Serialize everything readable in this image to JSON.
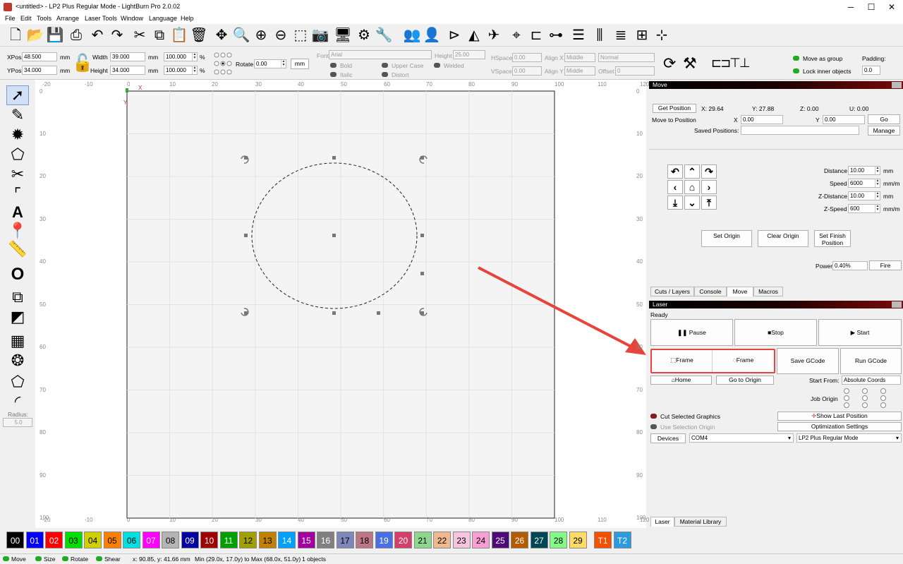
{
  "window": {
    "title": "<untitled> - LP2 Plus Regular Mode - LightBurn Pro 2.0.02",
    "min": "─",
    "max": "☐",
    "close": "✕"
  },
  "menu": [
    "File",
    "Edit",
    "Tools",
    "Arrange",
    "Laser Tools",
    "Window",
    "Language",
    "Help"
  ],
  "props": {
    "xpos_label": "XPos",
    "xpos": "48.500",
    "ypos_label": "YPos",
    "ypos": "34.000",
    "unit": "mm",
    "width_label": "Width",
    "width": "39.000",
    "height_label": "Height",
    "height": "34.000",
    "wpct": "100.000",
    "hpct": "100.000",
    "pct": "%",
    "rotate_label": "Rotate",
    "rotate": "0.00",
    "mm_button": "mm",
    "font_label": "Font",
    "font": "Arial",
    "fheight_label": "Height",
    "fheight": "25.00",
    "bold": "Bold",
    "italic": "Italic",
    "upper": "Upper Case",
    "distort": "Distort",
    "welded": "Welded",
    "hspace_label": "HSpace",
    "hspace": "0.00",
    "vspace_label": "VSpace",
    "vspace": "0.00",
    "alignx_label": "Align X",
    "alignx": "Middle",
    "aligny_label": "Align Y",
    "aligny": "Middle",
    "normal": "Normal",
    "offset_label": "Offset",
    "offset": "0",
    "move_group": "Move as group",
    "lock_inner": "Lock inner objects",
    "padding_label": "Padding:",
    "padding": "0.0"
  },
  "toolbox": {
    "radius_label": "Radius:",
    "radius": "5.0"
  },
  "ruler": {
    "x": [
      "-20",
      "-10",
      "0",
      "10",
      "20",
      "30",
      "40",
      "50",
      "60",
      "70",
      "80",
      "90",
      "100",
      "110",
      "120"
    ],
    "y": [
      "0",
      "10",
      "20",
      "30",
      "40",
      "50",
      "60",
      "70",
      "80",
      "90",
      "100"
    ],
    "x_axis": "X",
    "y_axis": "Y",
    "corner": "-20"
  },
  "move": {
    "title": "Move",
    "get_position": "Get Position",
    "x_pos": "X: 29.64",
    "y_pos": "Y: 27.88",
    "z_pos": "Z: 0.00",
    "u_pos": "U: 0.00",
    "move_to": "Move to Position",
    "x_label": "X",
    "x_val": "0.00",
    "y_label": "Y",
    "y_val": "0.00",
    "go": "Go",
    "saved_label": "Saved Positions:",
    "manage": "Manage",
    "distance_label": "Distance",
    "distance": "10.00",
    "speed_label": "Speed",
    "speed": "6000",
    "zdist_label": "Z-Distance",
    "zdist": "10.00",
    "zspeed_label": "Z-Speed",
    "zspeed": "600",
    "mm": "mm",
    "mmmin": "mm/m",
    "set_origin": "Set Origin",
    "clear_origin": "Clear Origin",
    "set_finish": "Set Finish Position",
    "power_label": "Power",
    "power": "0.40%",
    "fire": "Fire"
  },
  "upper_tabs": [
    "Cuts / Layers",
    "Console",
    "Move",
    "Macros"
  ],
  "laser": {
    "title": "Laser",
    "status": "Ready",
    "pause": "Pause",
    "stop": "Stop",
    "start": "Start",
    "frame1": "Frame",
    "frame2": "Frame",
    "save_gcode": "Save GCode",
    "run_gcode": "Run GCode",
    "home": "Home",
    "go_origin": "Go to Origin",
    "start_from_label": "Start From:",
    "start_from": "Absolute Coords",
    "job_origin": "Job Origin",
    "cut_selected": "Cut Selected Graphics",
    "use_sel_origin": "Use Selection Origin",
    "show_last": "Show Last Position",
    "opt_settings": "Optimization Settings",
    "devices": "Devices",
    "port": "COM4",
    "device": "LP2 Plus Regular Mode"
  },
  "lower_tabs": [
    "Laser",
    "Material Library"
  ],
  "palette": [
    {
      "l": "00",
      "c": "#000000",
      "t": "#ffffff"
    },
    {
      "l": "01",
      "c": "#0000ff",
      "t": "#ffffff"
    },
    {
      "l": "02",
      "c": "#ff0000",
      "t": "#ffffff"
    },
    {
      "l": "03",
      "c": "#00e000",
      "t": "#000000"
    },
    {
      "l": "04",
      "c": "#d0d000",
      "t": "#000000"
    },
    {
      "l": "05",
      "c": "#ff8000",
      "t": "#000000"
    },
    {
      "l": "06",
      "c": "#00e0e0",
      "t": "#000000"
    },
    {
      "l": "07",
      "c": "#ff00ff",
      "t": "#ffffff"
    },
    {
      "l": "08",
      "c": "#b4b4b4",
      "t": "#000000"
    },
    {
      "l": "09",
      "c": "#0000a0",
      "t": "#ffffff"
    },
    {
      "l": "10",
      "c": "#a00000",
      "t": "#ffffff"
    },
    {
      "l": "11",
      "c": "#00a000",
      "t": "#ffffff"
    },
    {
      "l": "12",
      "c": "#a0a000",
      "t": "#000000"
    },
    {
      "l": "13",
      "c": "#c08000",
      "t": "#000000"
    },
    {
      "l": "14",
      "c": "#00a0ff",
      "t": "#ffffff"
    },
    {
      "l": "15",
      "c": "#a000a0",
      "t": "#ffffff"
    },
    {
      "l": "16",
      "c": "#808080",
      "t": "#ffffff"
    },
    {
      "l": "17",
      "c": "#7d87b9",
      "t": "#000000"
    },
    {
      "l": "18",
      "c": "#bb7784",
      "t": "#000000"
    },
    {
      "l": "19",
      "c": "#4a6fe3",
      "t": "#ffffff"
    },
    {
      "l": "20",
      "c": "#d33f6a",
      "t": "#ffffff"
    },
    {
      "l": "21",
      "c": "#8cd78c",
      "t": "#000000"
    },
    {
      "l": "22",
      "c": "#f0b98d",
      "t": "#000000"
    },
    {
      "l": "23",
      "c": "#f6c4e1",
      "t": "#000000"
    },
    {
      "l": "24",
      "c": "#fa9ed4",
      "t": "#000000"
    },
    {
      "l": "25",
      "c": "#500a78",
      "t": "#ffffff"
    },
    {
      "l": "26",
      "c": "#b45a00",
      "t": "#ffffff"
    },
    {
      "l": "27",
      "c": "#004754",
      "t": "#ffffff"
    },
    {
      "l": "28",
      "c": "#86fa88",
      "t": "#000000"
    },
    {
      "l": "29",
      "c": "#ffdb66",
      "t": "#000000"
    },
    {
      "l": "T1",
      "c": "#f35000",
      "t": "#ffffff"
    },
    {
      "l": "T2",
      "c": "#2b9adf",
      "t": "#ffffff"
    }
  ],
  "status": {
    "move": "Move",
    "size": "Size",
    "rotate": "Rotate",
    "shear": "Shear",
    "coords": "x: 90.85, y: 41.66 mm",
    "bounds": "Min (29.0x, 17.0y) to Max (68.0x, 51.0y)",
    "objects": "1 objects"
  }
}
